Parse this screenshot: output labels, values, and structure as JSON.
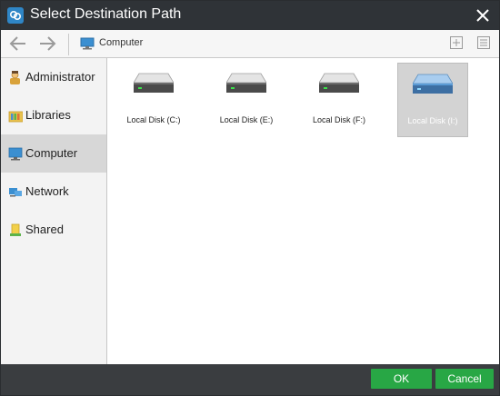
{
  "window": {
    "title": "Select Destination Path"
  },
  "toolbar": {
    "breadcrumb": "Computer"
  },
  "sidebar": {
    "items": [
      {
        "label": "Administrator",
        "icon": "user-icon"
      },
      {
        "label": "Libraries",
        "icon": "libraries-icon"
      },
      {
        "label": "Computer",
        "icon": "computer-icon",
        "active": true
      },
      {
        "label": "Network",
        "icon": "network-icon"
      },
      {
        "label": "Shared",
        "icon": "shared-icon"
      }
    ]
  },
  "drives": [
    {
      "label": "Local Disk (C:)"
    },
    {
      "label": "Local Disk (E:)"
    },
    {
      "label": "Local Disk (F:)"
    },
    {
      "label": "Local Disk (I:)",
      "selected": true
    }
  ],
  "footer": {
    "ok_label": "OK",
    "cancel_label": "Cancel"
  },
  "colors": {
    "titlebar": "#2f3337",
    "footer": "#3a3d40",
    "button_green": "#28a745",
    "selection": "#d3d3d3",
    "drive_selected_blue": "#5b9bd5"
  }
}
